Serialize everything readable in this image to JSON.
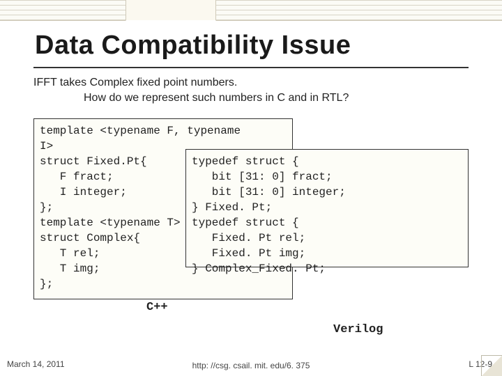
{
  "title": "Data Compatibility Issue",
  "subtitle_line1": "IFFT takes Complex fixed point numbers.",
  "subtitle_line2": "How do we represent such numbers in C and in RTL?",
  "code_cpp": "template <typename F, typename\nI>\nstruct Fixed.Pt{\n   F fract;\n   I integer;\n};\ntemplate <typename T>\nstruct Complex{\n   T rel;\n   T img;\n};",
  "code_verilog": "typedef struct {\n   bit [31: 0] fract;\n   bit [31: 0] integer;\n} Fixed. Pt;\ntypedef struct {\n   Fixed. Pt rel;\n   Fixed. Pt img;\n} Complex_Fixed. Pt;",
  "label_cpp": "C++",
  "label_verilog": "Verilog",
  "footer": {
    "date": "March 14, 2011",
    "url": "http: //csg. csail. mit. edu/6. 375",
    "pageno": "L 12-9"
  }
}
